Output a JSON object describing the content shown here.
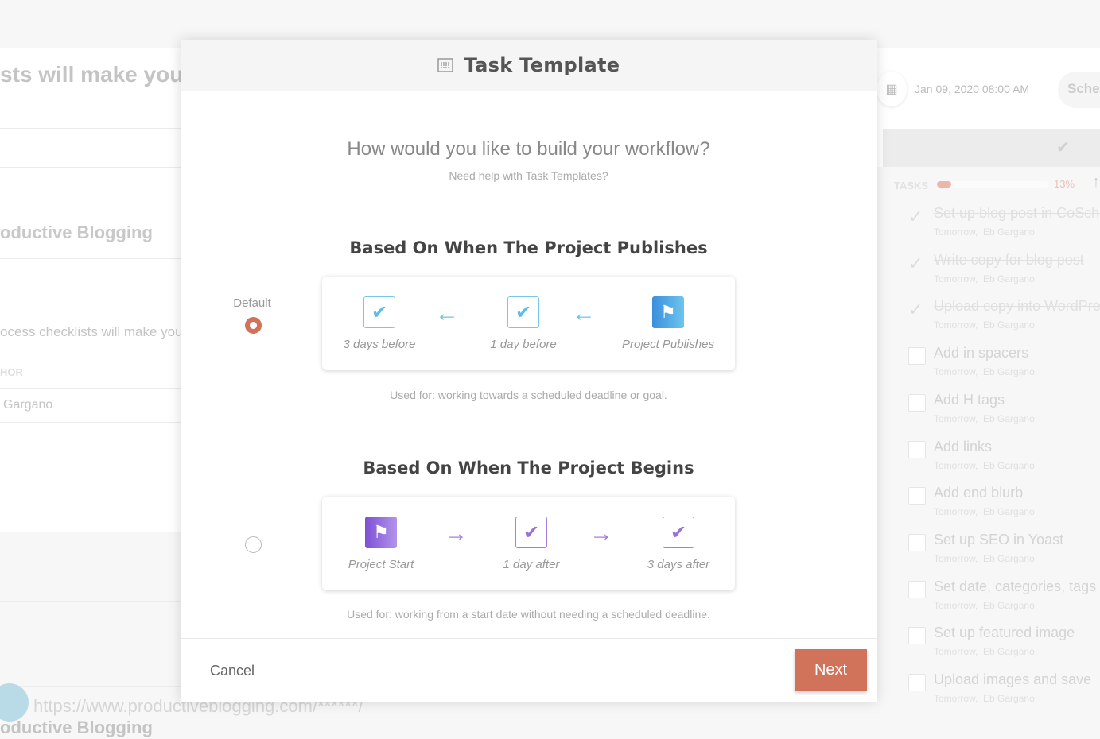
{
  "background": {
    "left": {
      "title": "sts will make you",
      "subtitle": "oductive Blogging",
      "desc": "ocess checklists will make you",
      "author_label": "HOR",
      "author": "Gargano",
      "url": "https://www.productiveblogging.com/******/",
      "footer_title": "oductive Blogging"
    },
    "right": {
      "date": "Jan 09, 2020 08:00 AM",
      "schedule_label": "Sche",
      "tasks_label": "TASKS",
      "progress_text": "13%",
      "progress_value": 13,
      "tasks": [
        {
          "title": "Set up blog post in CoSchedule",
          "due": "Tomorrow,",
          "assignee": "Eb Gargano",
          "done": true
        },
        {
          "title": "Write copy for blog post",
          "due": "Tomorrow,",
          "assignee": "Eb Gargano",
          "done": true
        },
        {
          "title": "Upload copy into WordPress",
          "due": "Tomorrow,",
          "assignee": "Eb Gargano",
          "done": true
        },
        {
          "title": "Add in spacers",
          "due": "Tomorrow,",
          "assignee": "Eb Gargano",
          "done": false
        },
        {
          "title": "Add H tags",
          "due": "Tomorrow,",
          "assignee": "Eb Gargano",
          "done": false
        },
        {
          "title": "Add links",
          "due": "Tomorrow,",
          "assignee": "Eb Gargano",
          "done": false
        },
        {
          "title": "Add end blurb",
          "due": "Tomorrow,",
          "assignee": "Eb Gargano",
          "done": false
        },
        {
          "title": "Set up SEO in Yoast",
          "due": "Tomorrow,",
          "assignee": "Eb Gargano",
          "done": false
        },
        {
          "title": "Set date, categories, tags and",
          "due": "Tomorrow,",
          "assignee": "Eb Gargano",
          "done": false
        },
        {
          "title": "Set up featured image",
          "due": "Tomorrow,",
          "assignee": "Eb Gargano",
          "done": false
        },
        {
          "title": "Upload images and save",
          "due": "Tomorrow,",
          "assignee": "Eb Gargano",
          "done": false
        }
      ]
    }
  },
  "modal": {
    "title": "Task Template",
    "icon": "template-icon",
    "question": "How would you like to build your workflow?",
    "help_link": "Need help with Task Templates?",
    "options": [
      {
        "heading": "Based On When The Project Publishes",
        "default_label": "Default",
        "selected": true,
        "steps": [
          "3 days before",
          "1 day before",
          "Project Publishes"
        ],
        "used_for": "Used for: working towards a scheduled deadline or goal."
      },
      {
        "heading": "Based On When The Project Begins",
        "selected": false,
        "steps": [
          "Project Start",
          "1 day after",
          "3 days after"
        ],
        "used_for": "Used for: working from a start date without needing a scheduled deadline."
      }
    ],
    "cancel": "Cancel",
    "next": "Next"
  },
  "colors": {
    "accent": "#d0735a",
    "blue": "#5bbde8",
    "purple": "#9b6fdc"
  }
}
